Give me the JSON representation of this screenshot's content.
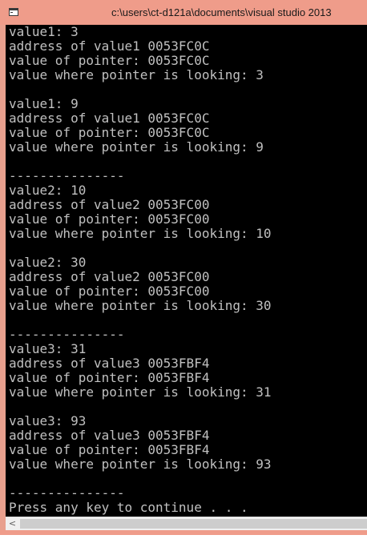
{
  "window": {
    "title": "c:\\users\\ct-d121a\\documents\\visual studio 2013"
  },
  "console": {
    "lines": [
      "value1: 3",
      "address of value1 0053FC0C",
      "value of pointer: 0053FC0C",
      "value where pointer is looking: 3",
      "",
      "value1: 9",
      "address of value1 0053FC0C",
      "value of pointer: 0053FC0C",
      "value where pointer is looking: 9",
      "",
      "---------------",
      "value2: 10",
      "address of value2 0053FC00",
      "value of pointer: 0053FC00",
      "value where pointer is looking: 10",
      "",
      "value2: 30",
      "address of value2 0053FC00",
      "value of pointer: 0053FC00",
      "value where pointer is looking: 30",
      "",
      "---------------",
      "value3: 31",
      "address of value3 0053FBF4",
      "value of pointer: 0053FBF4",
      "value where pointer is looking: 31",
      "",
      "value3: 93",
      "address of value3 0053FBF4",
      "value of pointer: 0053FBF4",
      "value where pointer is looking: 93",
      "",
      "---------------",
      "Press any key to continue . . ."
    ]
  },
  "scrollbar": {
    "left_arrow": "<"
  },
  "icons": {
    "app": "console-app-icon",
    "scroll_left": "chevron-left-icon"
  },
  "colors": {
    "titlebar": "#ef9c8a",
    "console_background": "#000000",
    "console_text": "#c0c0c0"
  }
}
